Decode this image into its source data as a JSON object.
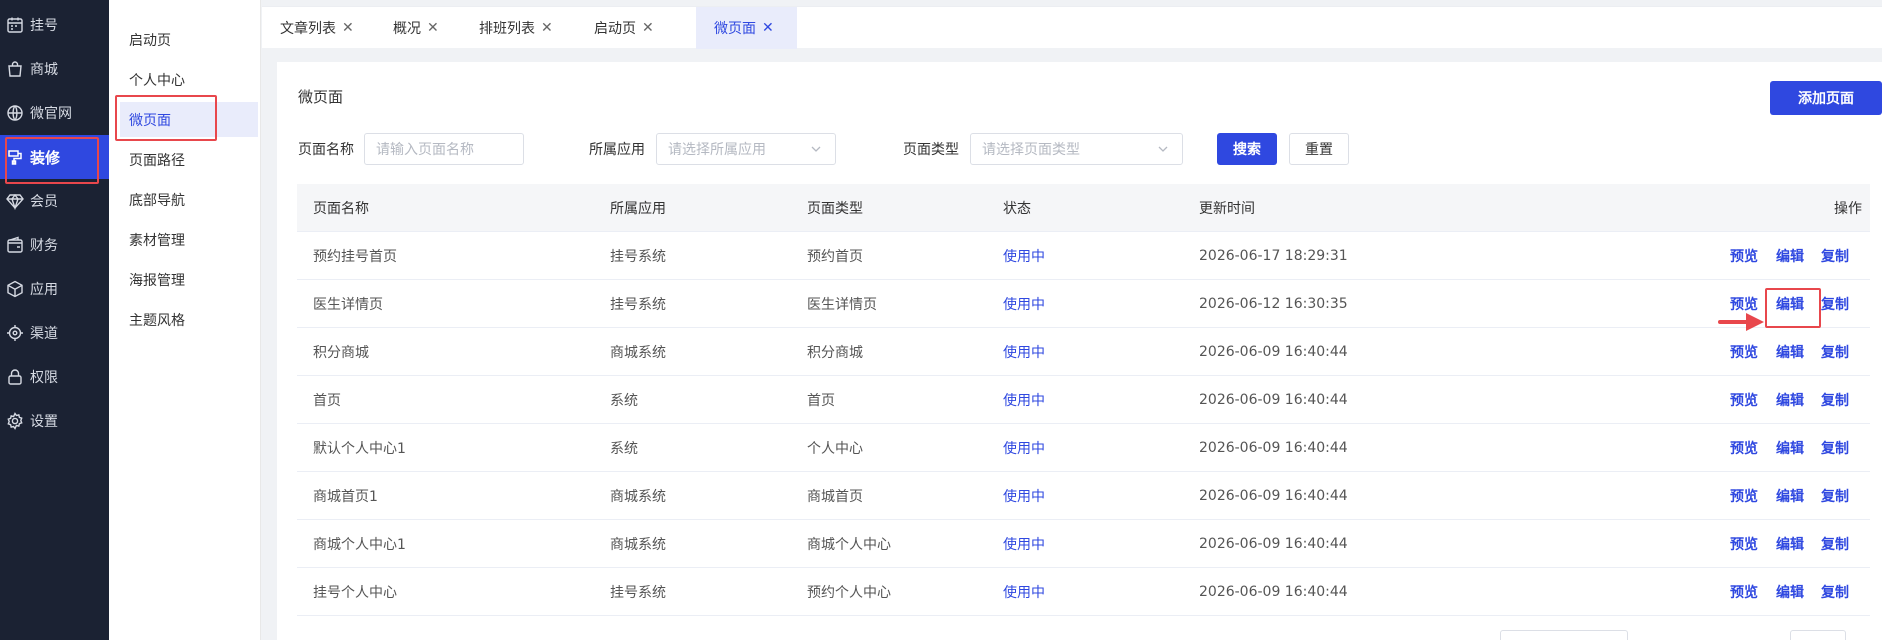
{
  "sidebar": {
    "items": [
      {
        "label": "挂号",
        "icon": "calendar-icon"
      },
      {
        "label": "商城",
        "icon": "shopping-bag-icon"
      },
      {
        "label": "微官网",
        "icon": "globe-icon"
      },
      {
        "label": "装修",
        "icon": "decoration-icon",
        "active": true
      },
      {
        "label": "会员",
        "icon": "diamond-icon"
      },
      {
        "label": "财务",
        "icon": "wallet-icon"
      },
      {
        "label": "应用",
        "icon": "cube-icon"
      },
      {
        "label": "渠道",
        "icon": "channel-icon"
      },
      {
        "label": "权限",
        "icon": "lock-icon"
      },
      {
        "label": "设置",
        "icon": "gear-icon"
      }
    ]
  },
  "submenu": {
    "items": [
      {
        "label": "启动页"
      },
      {
        "label": "个人中心"
      },
      {
        "label": "微页面",
        "active": true
      },
      {
        "label": "页面路径"
      },
      {
        "label": "底部导航"
      },
      {
        "label": "素材管理"
      },
      {
        "label": "海报管理"
      },
      {
        "label": "主题风格"
      }
    ]
  },
  "tabs": [
    {
      "label": "文章列表",
      "close": "✕"
    },
    {
      "label": "概况",
      "close": "✕"
    },
    {
      "label": "排班列表",
      "close": "✕"
    },
    {
      "label": "启动页",
      "close": "✕"
    },
    {
      "label": "微页面",
      "close": "✕",
      "active": true
    }
  ],
  "page": {
    "title": "微页面",
    "add_button": "添加页面"
  },
  "filters": {
    "name_label": "页面名称",
    "name_placeholder": "请输入页面名称",
    "app_label": "所属应用",
    "app_placeholder": "请选择所属应用",
    "type_label": "页面类型",
    "type_placeholder": "请选择页面类型",
    "search_button": "搜索",
    "reset_button": "重置"
  },
  "table": {
    "headers": [
      "页面名称",
      "所属应用",
      "页面类型",
      "状态",
      "更新时间",
      "操作"
    ],
    "actions": [
      "预览",
      "编辑",
      "复制"
    ],
    "rows": [
      {
        "name": "预约挂号首页",
        "app": "挂号系统",
        "type": "预约首页",
        "status": "使用中",
        "updated": "2026-06-17 18:29:31"
      },
      {
        "name": "医生详情页",
        "app": "挂号系统",
        "type": "医生详情页",
        "status": "使用中",
        "updated": "2026-06-12 16:30:35"
      },
      {
        "name": "积分商城",
        "app": "商城系统",
        "type": "积分商城",
        "status": "使用中",
        "updated": "2026-06-09 16:40:44"
      },
      {
        "name": "首页",
        "app": "系统",
        "type": "首页",
        "status": "使用中",
        "updated": "2026-06-09 16:40:44"
      },
      {
        "name": "默认个人中心1",
        "app": "系统",
        "type": "个人中心",
        "status": "使用中",
        "updated": "2026-06-09 16:40:44"
      },
      {
        "name": "商城首页1",
        "app": "商城系统",
        "type": "商城首页",
        "status": "使用中",
        "updated": "2026-06-09 16:40:44"
      },
      {
        "name": "商城个人中心1",
        "app": "商城系统",
        "type": "商城个人中心",
        "status": "使用中",
        "updated": "2026-06-09 16:40:44"
      },
      {
        "name": "挂号个人中心",
        "app": "挂号系统",
        "type": "预约个人中心",
        "status": "使用中",
        "updated": "2026-06-09 16:40:44"
      }
    ]
  },
  "colors": {
    "sidebar_bg": "#1b2233",
    "accent": "#2f48e0",
    "highlight": "#e8474c"
  }
}
